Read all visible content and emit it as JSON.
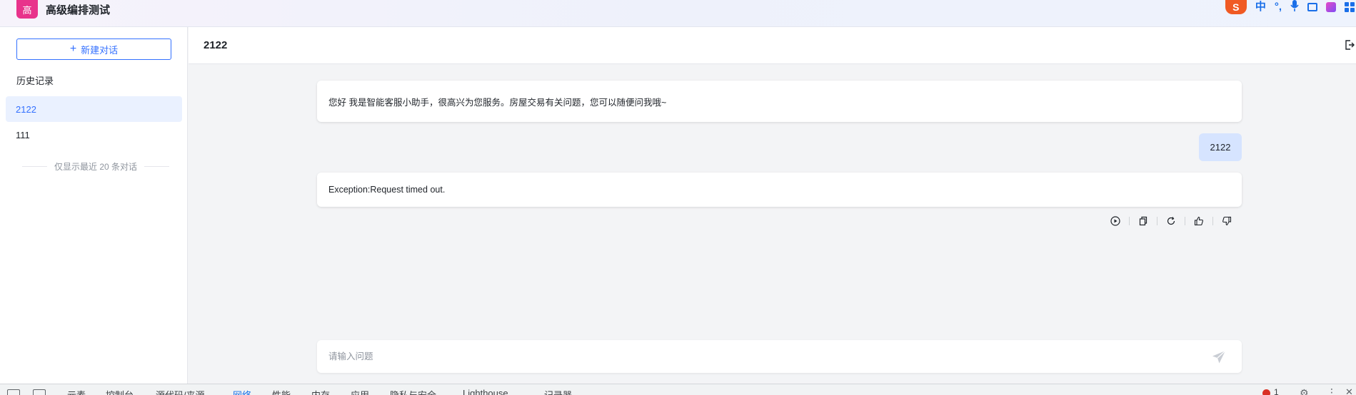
{
  "app": {
    "logo_char": "高",
    "title": "高级编排测试"
  },
  "ime_toolbar": {
    "logo": "S",
    "lang": "中",
    "punct": "°,",
    "icons": [
      "sogou-icon",
      "chinese-mode-icon",
      "punctuation-icon",
      "microphone-icon",
      "keyboard-icon",
      "skin-icon",
      "toolbox-icon"
    ]
  },
  "sidebar": {
    "new_chat_label": "新建对话",
    "history_title": "历史记录",
    "items": [
      {
        "label": "2122",
        "active": true
      },
      {
        "label": "111",
        "active": false
      }
    ],
    "footer_note": "仅显示最近 20 条对话"
  },
  "conversation": {
    "title": "2122",
    "messages": [
      {
        "role": "bot",
        "text": "您好 我是智能客服小助手，很高兴为您服务。房屋交易有关问题，您可以随便问我哦~"
      },
      {
        "role": "user",
        "text": "2122"
      },
      {
        "role": "bot",
        "text": "Exception:Request timed out."
      }
    ],
    "actions": [
      "play-icon",
      "copy-icon",
      "regenerate-icon",
      "thumbs-up-icon",
      "thumbs-down-icon"
    ]
  },
  "input": {
    "placeholder": "请输入问题"
  },
  "devtools": {
    "tabs": [
      "元素",
      "控制台",
      "源代码/来源",
      "网络",
      "性能",
      "内存",
      "应用",
      "隐私与安全",
      "Lighthouse",
      "记录器"
    ],
    "active_tab": "网络",
    "error_count": "1"
  },
  "colors": {
    "accent": "#3370ff",
    "logo_bg": "#e8338b",
    "user_bubble": "#d6e4ff",
    "active_history_bg": "#eaf1ff"
  }
}
